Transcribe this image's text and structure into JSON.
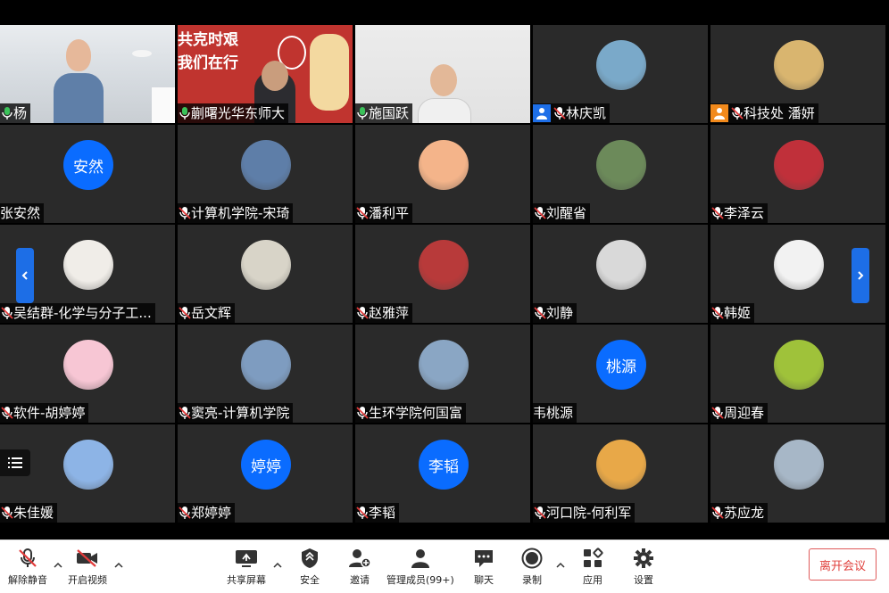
{
  "participants": [
    {
      "name": "杨",
      "mic": "on",
      "kind": "video",
      "scene": "office"
    },
    {
      "name": "蒯曙光华东师大",
      "mic": "on",
      "kind": "video",
      "scene": "poster",
      "poster_text": [
        "共克时艰",
        "我们在行"
      ]
    },
    {
      "name": "施国跃",
      "mic": "on",
      "kind": "video",
      "scene": "room"
    },
    {
      "name": "林庆凯",
      "mic": "muted",
      "host_icon": "blue",
      "kind": "avatar",
      "avatar_color": "#7aa9c9"
    },
    {
      "name": "科技处 潘妍",
      "mic": "muted",
      "host_icon": "orange",
      "kind": "avatar",
      "avatar_color": "#d9b56f"
    },
    {
      "name": "张安然",
      "mic": "none",
      "kind": "text",
      "avatar_text": "安然"
    },
    {
      "name": "计算机学院-宋琦",
      "mic": "muted",
      "kind": "avatar",
      "avatar_color": "#5e7ea8"
    },
    {
      "name": "潘利平",
      "mic": "muted",
      "kind": "avatar",
      "avatar_color": "#f4b48a"
    },
    {
      "name": "刘醒省",
      "mic": "muted",
      "kind": "avatar",
      "avatar_color": "#6c8a5a"
    },
    {
      "name": "李泽云",
      "mic": "muted",
      "kind": "avatar",
      "avatar_color": "#c0303a"
    },
    {
      "name": "吴结群-化学与分子工...",
      "mic": "muted",
      "kind": "avatar",
      "avatar_color": "#f0ede8"
    },
    {
      "name": "岳文辉",
      "mic": "muted",
      "kind": "avatar",
      "avatar_color": "#d8d4c8"
    },
    {
      "name": "赵雅萍",
      "mic": "muted",
      "kind": "avatar",
      "avatar_color": "#b83a3a"
    },
    {
      "name": "刘静",
      "mic": "muted",
      "kind": "avatar",
      "avatar_color": "#d9d9d9"
    },
    {
      "name": "韩姬",
      "mic": "muted",
      "kind": "avatar",
      "avatar_color": "#f2f2f2"
    },
    {
      "name": "软件-胡婷婷",
      "mic": "muted",
      "kind": "avatar",
      "avatar_color": "#f7c6d4"
    },
    {
      "name": "窦亮-计算机学院",
      "mic": "muted",
      "kind": "avatar",
      "avatar_color": "#7e9cc0"
    },
    {
      "name": "生环学院何国富",
      "mic": "muted",
      "kind": "avatar",
      "avatar_color": "#8aa6c4"
    },
    {
      "name": "韦桃源",
      "mic": "none",
      "kind": "text",
      "avatar_text": "桃源"
    },
    {
      "name": "周迎春",
      "mic": "muted",
      "kind": "avatar",
      "avatar_color": "#9fc23a"
    },
    {
      "name": "朱佳媛",
      "mic": "muted",
      "kind": "avatar",
      "avatar_color": "#8db4e6"
    },
    {
      "name": "郑婷婷",
      "mic": "muted",
      "kind": "text",
      "avatar_text": "婷婷"
    },
    {
      "name": "李韬",
      "mic": "muted",
      "kind": "text",
      "avatar_text": "李韬"
    },
    {
      "name": "河口院-何利军",
      "mic": "muted",
      "kind": "avatar",
      "avatar_color": "#e8a848"
    },
    {
      "name": "苏应龙",
      "mic": "muted",
      "kind": "avatar",
      "avatar_color": "#a7b7c7"
    }
  ],
  "toolbar": {
    "unmute_label": "解除静音",
    "start_video_label": "开启视频",
    "share_screen_label": "共享屏幕",
    "security_label": "安全",
    "invite_label": "邀请",
    "manage_members_label": "管理成员(99+)",
    "chat_label": "聊天",
    "record_label": "录制",
    "apps_label": "应用",
    "settings_label": "设置",
    "leave_label": "离开会议"
  },
  "colors": {
    "text_avatar": "#0a6cff",
    "pager": "#1d6ee6",
    "leave_border": "#e05a5a",
    "host_blue": "#1e6fe8",
    "host_orange": "#f28a1c",
    "mic_muted": "#e23b3b",
    "mic_on": "#3bc25a"
  }
}
